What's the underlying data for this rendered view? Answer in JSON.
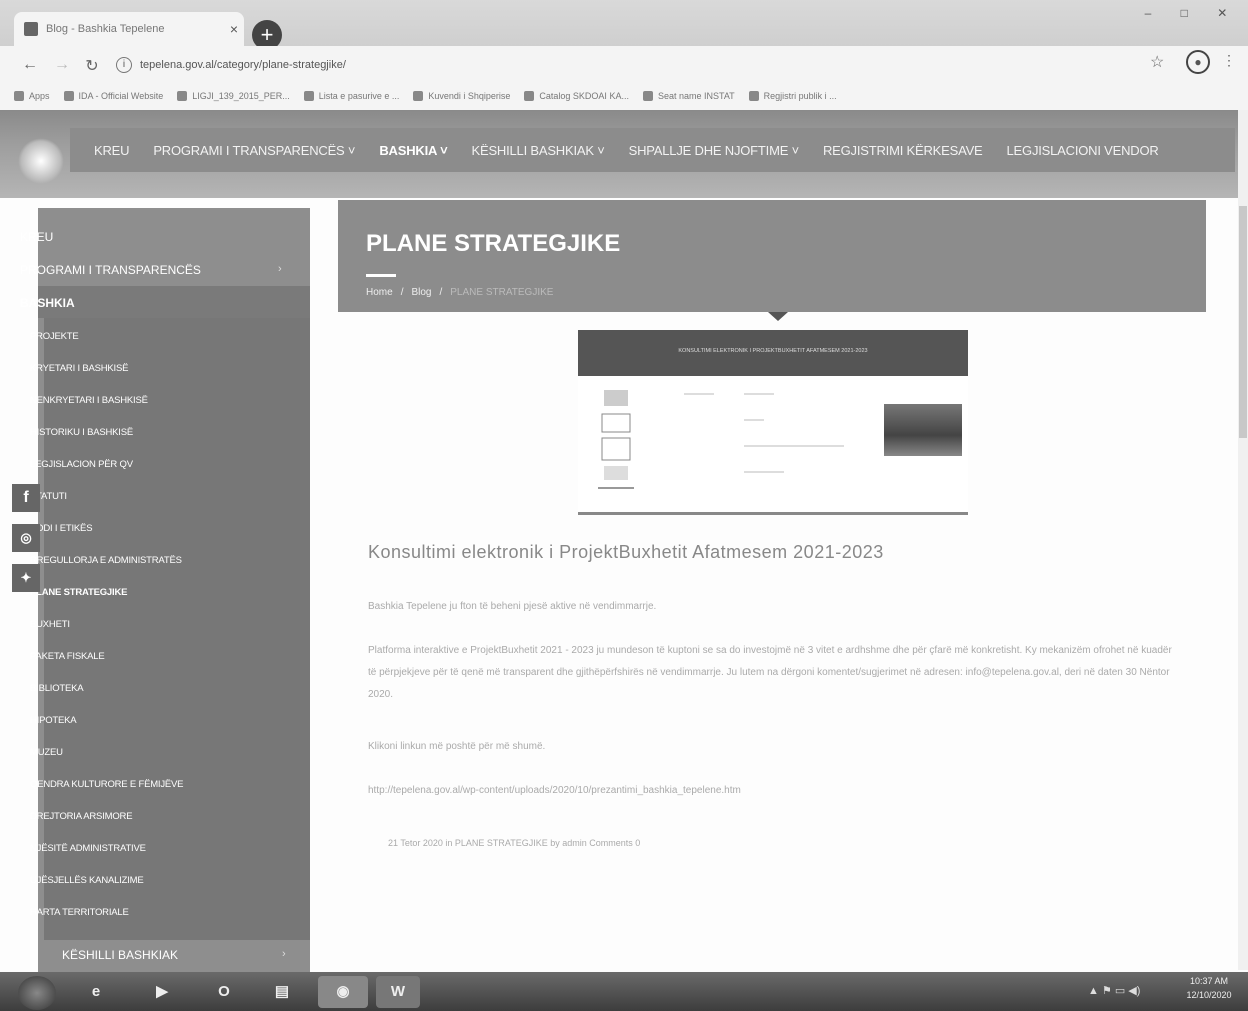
{
  "browser": {
    "tab_title": "Blog - Bashkia Tepelene",
    "tab_close": "×",
    "new_tab": "+",
    "url": "tepelena.gov.al/category/plane-strategjike/",
    "bookmarks": [
      "Apps",
      "IDA - Official Website",
      "LIGJI_139_2015_PER...",
      "Lista e pasurive e ...",
      "Kuvendi i Shqiperise",
      "Catalog SKDOAI KA...",
      "Seat name INSTAT",
      "Regjistri publik i ..."
    ]
  },
  "nav": {
    "items": [
      "KREU",
      "PROGRAMI I TRANSPARENCËS ˅",
      "BASHKIA ˅",
      "KËSHILLI BASHKIAK ˅",
      "SHPALLJE DHE NJOFTIME ˅",
      "REGJISTRIMI KËRKESAVE",
      "LEGJISLACIONI VENDOR"
    ],
    "active_index": 2
  },
  "sidebar": {
    "top": [
      "KREU",
      "PROGRAMI I TRANSPARENCËS",
      "BASHKIA"
    ],
    "sub": [
      "PROJEKTE",
      "KRYETARI I BASHKISË",
      "NENKRYETARI I BASHKISË",
      "HISTORIKU I BASHKISË",
      "LEGJISLACION PËR QV",
      "STATUTI",
      "KODI I ETIKËS",
      "RREGULLORJA E ADMINISTRATËS",
      "PLANE STRATEGJIKE",
      "BUXHETI",
      "PAKETA FISKALE",
      "BIBLIOTEKA",
      "HIPOTEKA",
      "MUZEU",
      "QENDRA KULTURORE E FËMIJËVE",
      "DREJTORIA ARSIMORE",
      "NJËSITË ADMINISTRATIVE",
      "UJËSJELLËS KANALIZIME",
      "HARTA TERRITORIALE"
    ],
    "bottom": "KËSHILLI BASHKIAK",
    "active_sub_index": 8
  },
  "page": {
    "title": "PLANE STRATEGJIKE",
    "breadcrumb": [
      "Home",
      "/",
      "Blog",
      "/",
      "PLANE STRATEGJIKE"
    ]
  },
  "featured_image": {
    "header_text": "KONSULTIMI ELEKTRONIK I PROJEKTBUXHETIT AFATMESEM 2021-2023"
  },
  "post": {
    "title": "Konsultimi elektronik i ProjektBuxhetit Afatmesem 2021-2023",
    "p1": "Bashkia Tepelene ju fton të beheni pjesë aktive në vendimmarrje.",
    "p2": "Platforma interaktive e ProjektBuxhetit 2021 - 2023 ju mundeson të kuptoni se sa do investojmë në 3 vitet e ardhshme dhe për çfarë më konkretisht. Ky mekanizëm ofrohet në kuadër të përpjekjeve për të qenë më transparent dhe gjithëpërfshirës në vendimmarrje. Ju lutem na dërgoni komentet/sugjerimet në adresen: info@tepelena.gov.al, deri në daten 30 Nëntor 2020.",
    "p3": "Klikoni linkun më poshtë për më shumë.",
    "p4": "http://tepelena.gov.al/wp-content/uploads/2020/10/prezantimi_bashkia_tepelene.htm",
    "meta": "21 Tetor 2020 in PLANE STRATEGJIKE by admin   Comments 0"
  },
  "taskbar": {
    "time": "10:37 AM",
    "date": "12/10/2020",
    "tray": "▲ ⚑ ▭ ◀)"
  }
}
